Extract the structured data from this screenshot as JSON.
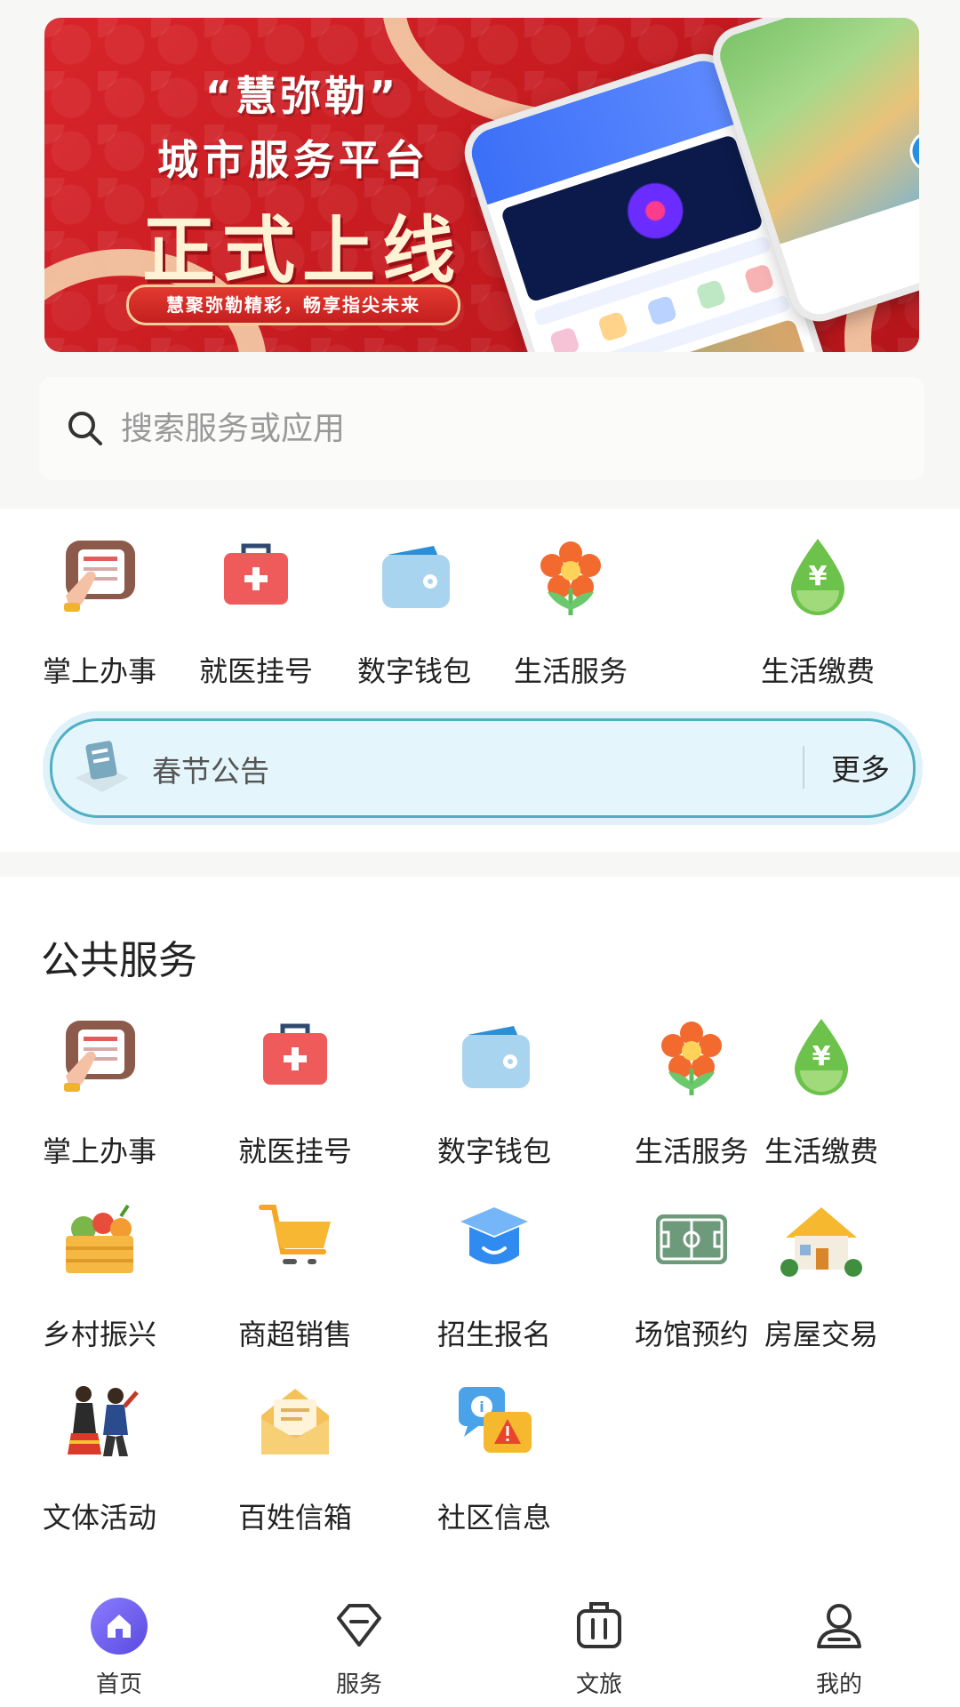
{
  "banner": {
    "quote": "“慧弥勒”",
    "subtitle": "城市服务平台",
    "headline": "正式上线",
    "slogan": "慧聚弥勒精彩，畅享指尖未来"
  },
  "search": {
    "placeholder": "搜索服务或应用"
  },
  "quick": {
    "items": [
      {
        "label": "掌上办事",
        "icon": "hand-document-icon"
      },
      {
        "label": "就医挂号",
        "icon": "medical-kit-icon"
      },
      {
        "label": "数字钱包",
        "icon": "wallet-icon"
      },
      {
        "label": "生活服务",
        "icon": "flower-icon"
      },
      {
        "label": "生活缴费",
        "icon": "yuan-drop-icon"
      }
    ]
  },
  "notice": {
    "text": "春节公告",
    "more": "更多"
  },
  "public_services": {
    "title": "公共服务",
    "items": [
      {
        "label": "掌上办事",
        "icon": "hand-document-icon"
      },
      {
        "label": "就医挂号",
        "icon": "medical-kit-icon"
      },
      {
        "label": "数字钱包",
        "icon": "wallet-icon"
      },
      {
        "label": "生活服务",
        "icon": "flower-icon"
      },
      {
        "label": "生活缴费",
        "icon": "yuan-drop-icon"
      },
      {
        "label": "乡村振兴",
        "icon": "produce-crate-icon"
      },
      {
        "label": "商超销售",
        "icon": "shopping-cart-icon"
      },
      {
        "label": "招生报名",
        "icon": "graduation-cap-icon"
      },
      {
        "label": "场馆预约",
        "icon": "stadium-field-icon"
      },
      {
        "label": "房屋交易",
        "icon": "house-icon"
      },
      {
        "label": "文体活动",
        "icon": "dancers-icon"
      },
      {
        "label": "百姓信箱",
        "icon": "envelope-icon"
      },
      {
        "label": "社区信息",
        "icon": "info-alert-icon"
      }
    ]
  },
  "tabbar": {
    "active": "首页",
    "items": [
      {
        "label": "首页",
        "icon": "home-icon"
      },
      {
        "label": "服务",
        "icon": "diamond-service-icon"
      },
      {
        "label": "文旅",
        "icon": "luggage-icon"
      },
      {
        "label": "我的",
        "icon": "user-icon"
      }
    ]
  },
  "colors": {
    "banner_red": "#d8252a",
    "notice_bg": "#e4f5fb",
    "notice_border": "#4fb0c2",
    "tab_active": "#6b5cf0"
  }
}
